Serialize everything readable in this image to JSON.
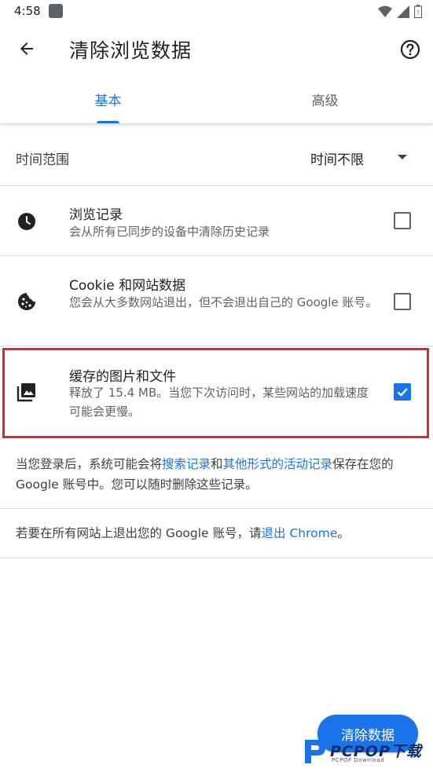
{
  "status_bar": {
    "time": "4:58",
    "icons": [
      "notification-icon",
      "wifi-icon",
      "signal-icon",
      "battery-icon"
    ]
  },
  "header": {
    "title": "清除浏览数据",
    "back_icon": "back-arrow-icon",
    "help_icon": "help-icon"
  },
  "tabs": [
    {
      "label": "基本",
      "selected": true
    },
    {
      "label": "高级",
      "selected": false
    }
  ],
  "time_range": {
    "label": "时间范围",
    "value": "时间不限"
  },
  "options": [
    {
      "title": "浏览记录",
      "subtitle": "会从所有已同步的设备中清除历史记录",
      "icon": "history-clock-icon",
      "checked": false
    },
    {
      "title": "Cookie 和网站数据",
      "subtitle": "您会从大多数网站退出，但不会退出自己的 Google 账号。",
      "icon": "cookie-icon",
      "checked": false
    },
    {
      "title": "缓存的图片和文件",
      "subtitle": "释放了 15.4 MB。当您下次访问时，某些网站的加载速度可能会更慢。",
      "icon": "image-collection-icon",
      "checked": true
    }
  ],
  "info": {
    "prefix": "当您登录后，系统可能会将",
    "link1": "搜索记录",
    "middle": "和",
    "link2": "其他形式的活动记录",
    "suffix": "保存在您的 Google 账号中。您可以随时删除这些记录。"
  },
  "signout": {
    "prefix": "若要在所有网站上退出您的 Google 账号，请",
    "link": "退出 Chrome",
    "suffix": "。"
  },
  "clear_button": "清除数据",
  "watermark": {
    "text": "PCPOP下载",
    "sub": "PCPOP Download"
  },
  "colors": {
    "accent": "#1a73e8",
    "highlight": "#d32f2f"
  }
}
